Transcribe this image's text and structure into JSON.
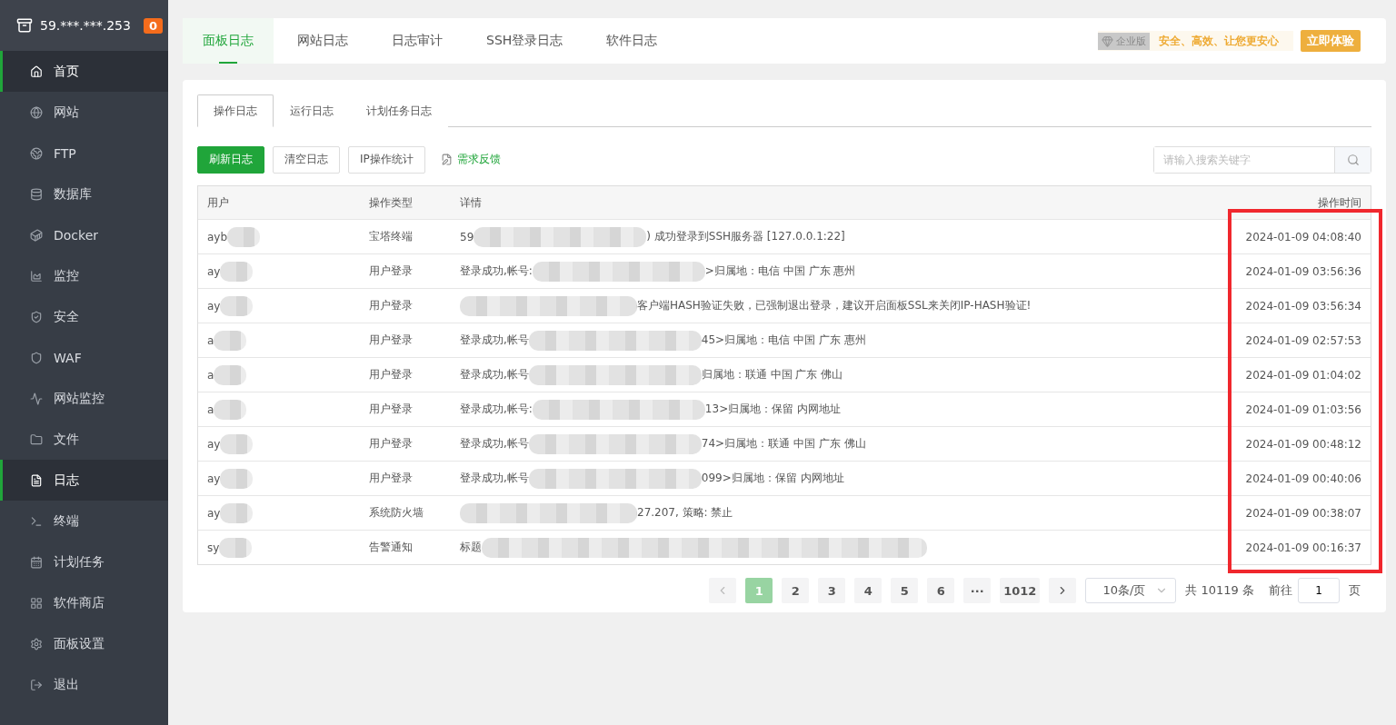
{
  "sidebar": {
    "host": "59.***.***.253",
    "badge": "0",
    "items": [
      {
        "label": "首页",
        "selected": true
      },
      {
        "label": "网站",
        "selected": false
      },
      {
        "label": "FTP",
        "selected": false
      },
      {
        "label": "数据库",
        "selected": false
      },
      {
        "label": "Docker",
        "selected": false
      },
      {
        "label": "监控",
        "selected": false
      },
      {
        "label": "安全",
        "selected": false
      },
      {
        "label": "WAF",
        "selected": false
      },
      {
        "label": "网站监控",
        "selected": false
      },
      {
        "label": "文件",
        "selected": false
      },
      {
        "label": "日志",
        "selected": true
      },
      {
        "label": "终端",
        "selected": false
      },
      {
        "label": "计划任务",
        "selected": false
      },
      {
        "label": "软件商店",
        "selected": false
      },
      {
        "label": "面板设置",
        "selected": false
      },
      {
        "label": "退出",
        "selected": false
      }
    ]
  },
  "top_tabs": [
    {
      "label": "面板日志",
      "selected": true
    },
    {
      "label": "网站日志",
      "selected": false
    },
    {
      "label": "日志审计",
      "selected": false
    },
    {
      "label": "SSH登录日志",
      "selected": false
    },
    {
      "label": "软件日志",
      "selected": false
    }
  ],
  "promo": {
    "edition": "企业版",
    "slogan": "安全、高效、让您更安心",
    "button": "立即体验"
  },
  "sub_tabs": [
    {
      "label": "操作日志",
      "selected": true
    },
    {
      "label": "运行日志",
      "selected": false
    },
    {
      "label": "计划任务日志",
      "selected": false
    }
  ],
  "toolbar": {
    "buttons": [
      {
        "label": "刷新日志",
        "primary": true
      },
      {
        "label": "清空日志",
        "primary": false
      },
      {
        "label": "IP操作统计",
        "primary": false
      }
    ],
    "link": "需求反馈",
    "search_placeholder": "请输入搜索关键字"
  },
  "table": {
    "columns": [
      "用户",
      "操作类型",
      "详情",
      "操作时间"
    ],
    "rows": [
      {
        "user": "ayb",
        "type": "宝塔终端",
        "detail_start": "59",
        "detail_end": ") 成功登录到SSH服务器 [127.0.0.1:22]",
        "time": "2024-01-09 04:08:40"
      },
      {
        "user": "ay",
        "type": "用户登录",
        "detail_start": "登录成功,帐号:",
        "detail_end": ">归属地：电信 中国 广东 惠州",
        "time": "2024-01-09 03:56:36"
      },
      {
        "user": "ay",
        "type": "用户登录",
        "detail_start": "",
        "detail_end": "客户端HASH验证失败，已强制退出登录，建议开启面板SSL来关闭IP-HASH验证!",
        "time": "2024-01-09 03:56:34"
      },
      {
        "user": "a",
        "type": "用户登录",
        "detail_start": "登录成功,帐号",
        "detail_end": "45>归属地：电信 中国 广东 惠州",
        "time": "2024-01-09 02:57:53"
      },
      {
        "user": "a",
        "type": "用户登录",
        "detail_start": "登录成功,帐号",
        "detail_end": "归属地：联通 中国 广东 佛山",
        "time": "2024-01-09 01:04:02"
      },
      {
        "user": "a",
        "type": "用户登录",
        "detail_start": "登录成功,帐号:",
        "detail_end": "13>归属地：保留 内网地址",
        "time": "2024-01-09 01:03:56"
      },
      {
        "user": "ay",
        "type": "用户登录",
        "detail_start": "登录成功,帐号",
        "detail_end": "74>归属地：联通 中国 广东 佛山",
        "time": "2024-01-09 00:48:12"
      },
      {
        "user": "ay",
        "type": "用户登录",
        "detail_start": "登录成功,帐号",
        "detail_end": "099>归属地：保留 内网地址",
        "time": "2024-01-09 00:40:06"
      },
      {
        "user": "ay",
        "type": "系统防火墙",
        "detail_start": "",
        "detail_end": "27.207, 策略: 禁止",
        "time": "2024-01-09 00:38:07"
      },
      {
        "user": "sy",
        "type": "告警通知",
        "detail_start": "标题",
        "detail_end": "",
        "time": "2024-01-09 00:16:37"
      }
    ]
  },
  "pagination": {
    "prev_disabled": true,
    "pages": [
      {
        "label": "1",
        "selected": true
      },
      {
        "label": "2",
        "selected": false
      },
      {
        "label": "3",
        "selected": false
      },
      {
        "label": "4",
        "selected": false
      },
      {
        "label": "5",
        "selected": false
      },
      {
        "label": "6",
        "selected": false
      },
      {
        "label": "···",
        "selected": false
      },
      {
        "label": "1012",
        "selected": false
      }
    ],
    "page_size": "10条/页",
    "total": "共 10119 条",
    "goto_label": "前往",
    "goto_value": "1",
    "goto_unit": "页"
  },
  "annotation": {
    "kind": "box"
  }
}
